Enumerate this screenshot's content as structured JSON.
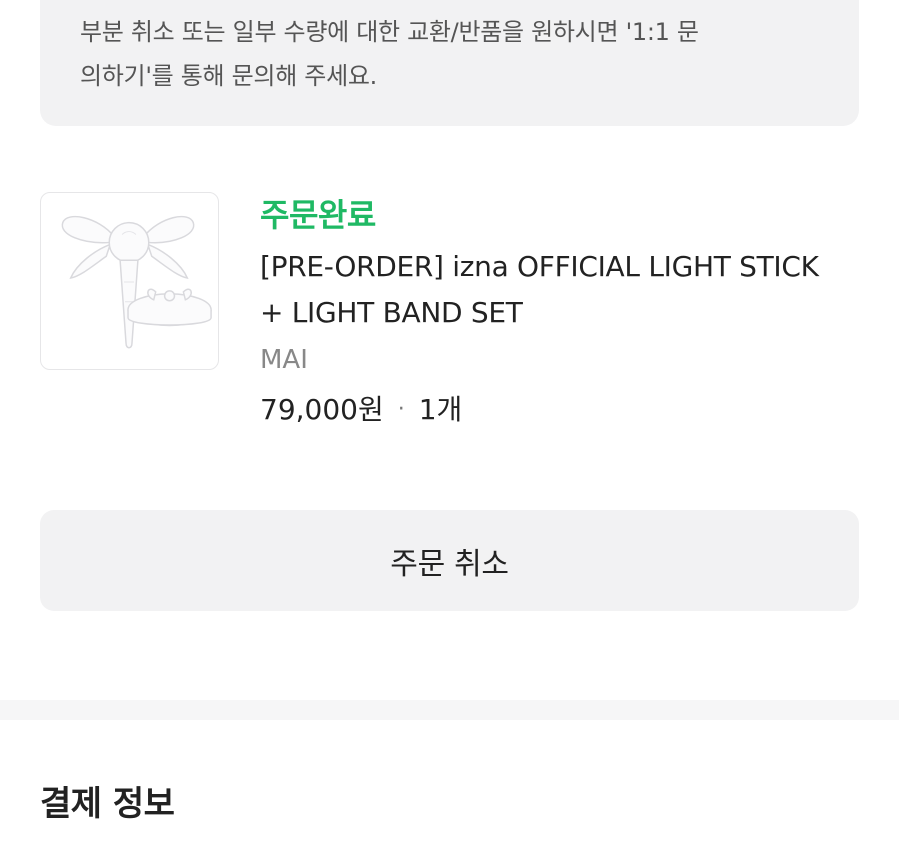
{
  "notice": {
    "text": "부분 취소 또는 일부 수량에 대한 교환/반품을 원하시면 '1:1 문\n의하기'를 통해 문의해 주세요."
  },
  "order_item": {
    "status": "주문완료",
    "status_color": "#1fb964",
    "product_name": "[PRE-ORDER] izna OFFICIAL LIGHT STICK + LIGHT BAND SET",
    "seller": "MAI",
    "price": "79,000원",
    "separator": "·",
    "quantity": "1개",
    "thumbnail_icon": "light-stick-product-image"
  },
  "actions": {
    "cancel_label": "주문 취소"
  },
  "payment_section": {
    "title": "결제 정보"
  }
}
